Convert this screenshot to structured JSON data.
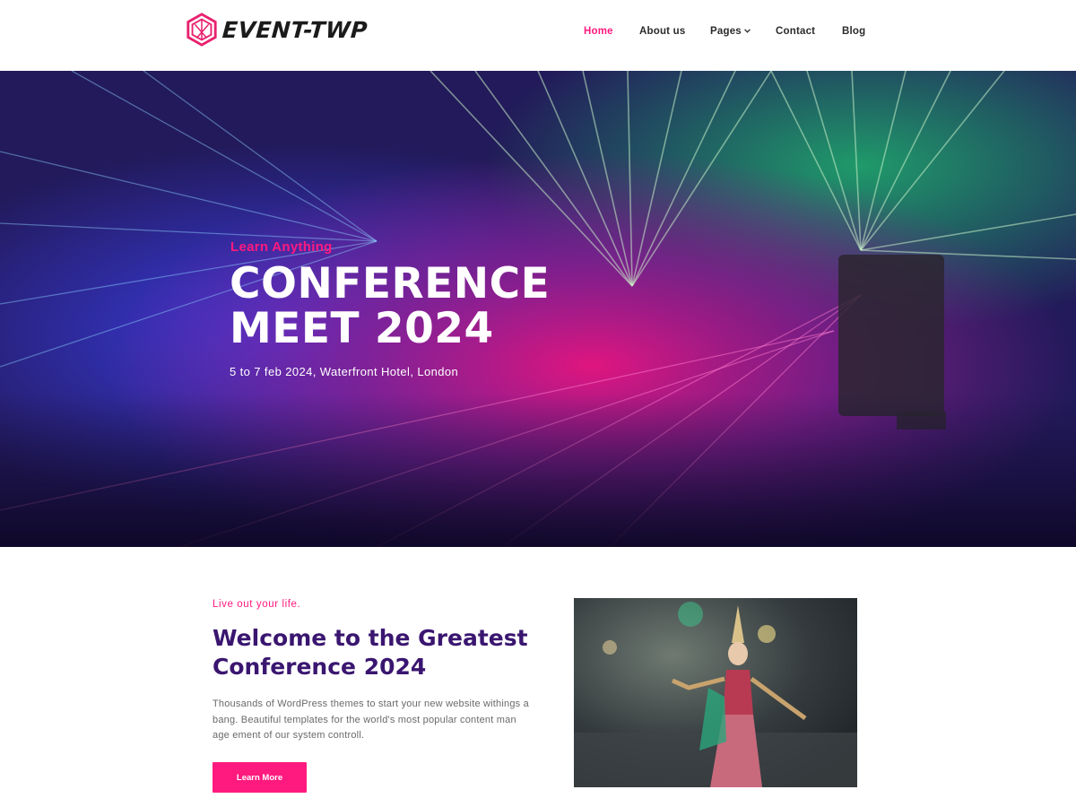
{
  "brand": {
    "name": "EVENT-TWP",
    "accent": "#ff1a7f",
    "heading_color": "#3a1670"
  },
  "nav": {
    "items": [
      {
        "label": "Home",
        "active": true
      },
      {
        "label": "About us",
        "active": false
      },
      {
        "label": "Pages",
        "active": false,
        "icon": "chevron-down-icon"
      },
      {
        "label": "Contact",
        "active": false
      },
      {
        "label": "Blog",
        "active": false
      }
    ]
  },
  "hero": {
    "kicker": "Learn Anything",
    "title_line1": "CONFERENCE",
    "title_line2": "MEET 2024",
    "subtitle": "5 to 7 feb 2024, Waterfront Hotel, London"
  },
  "welcome": {
    "kicker": "Live out your life.",
    "title_line1": "Welcome to the Greatest",
    "title_line2": "Conference 2024",
    "text": "Thousands of WordPress themes to start your new website withings a bang. Beautiful templates for the world's most popular content man age ement of our system controll.",
    "button_label": "Learn More"
  }
}
